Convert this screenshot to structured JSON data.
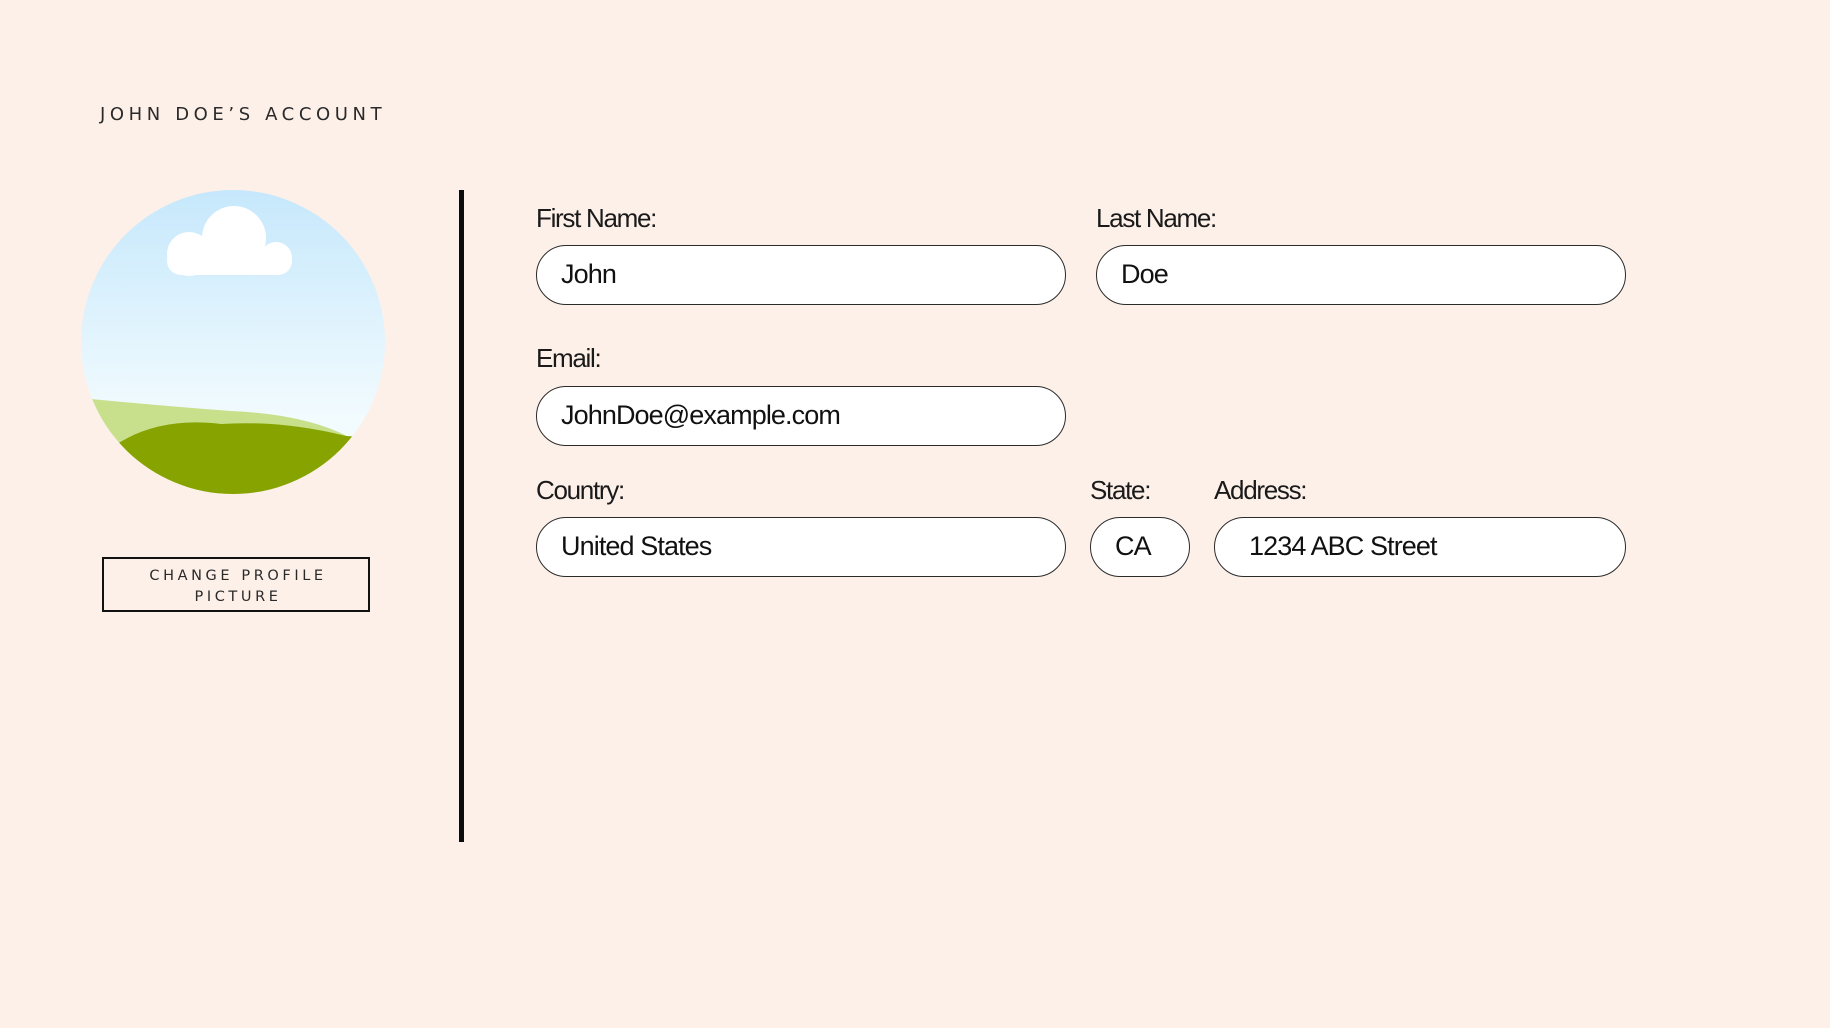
{
  "header": {
    "title": "JOHN DOE’S ACCOUNT"
  },
  "profile": {
    "avatar_icon": "landscape-image-icon",
    "change_button": "CHANGE PROFILE PICTURE"
  },
  "form": {
    "first_name": {
      "label": "First Name:",
      "value": "John"
    },
    "last_name": {
      "label": "Last Name:",
      "value": "Doe"
    },
    "email": {
      "label": "Email:",
      "value": "JohnDoe@example.com"
    },
    "country": {
      "label": "Country:",
      "value": "United States"
    },
    "state": {
      "label": "State:",
      "value": "CA"
    },
    "address": {
      "label": "Address:",
      "value": "1234 ABC Street"
    }
  },
  "colors": {
    "background": "#fdf0e9",
    "field_background": "#ffffff",
    "border": "#2b2b2b",
    "sky_top": "#c6e8fc",
    "sky_bottom": "#f2fbfe",
    "hill_light": "#c8e08c",
    "hill_dark": "#87a300"
  }
}
